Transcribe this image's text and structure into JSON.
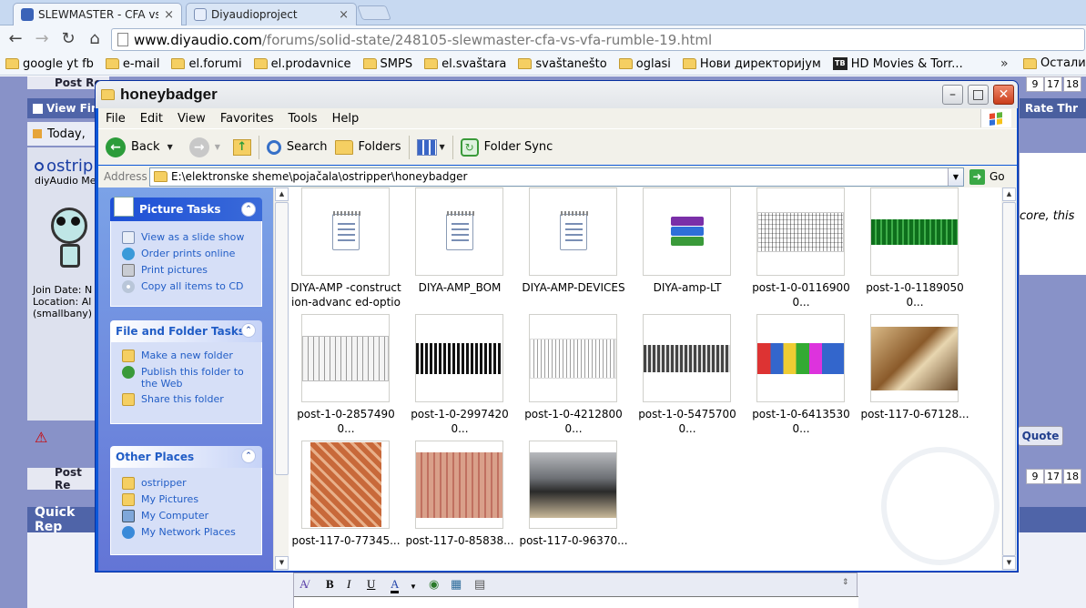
{
  "browser": {
    "tabs": [
      {
        "title": "SLEWMASTER - CFA vs.",
        "active": true,
        "close": "×"
      },
      {
        "title": "Diyaudioproject",
        "active": false,
        "close": "×"
      }
    ],
    "url_host": "www.diyaudio.com",
    "url_path": "/forums/solid-state/248105-slewmaster-cfa-vs-vfa-rumble-19.html",
    "bookmarks": [
      "google yt fb",
      "e-mail",
      "el.forumi",
      "el.prodavnice",
      "SMPS",
      "el.svaštara",
      "svaštanešto",
      "oglasi",
      "Нови директоријум",
      "HD Movies & Torr..."
    ],
    "bookmarks_more": "»",
    "bookmarks_other": "Остали о",
    "tb_logo": "TB"
  },
  "forum": {
    "post_reply": "Post Re",
    "view_first": "View Fir",
    "today": "Today,",
    "username": "ostrip",
    "user_title": "diyAudio Me",
    "join_date": "Join Date: N",
    "location": "Location: Al",
    "smallbany": "(smallbany)",
    "rate_thread": "Rate Thr",
    "page_numbers": [
      "9",
      "17",
      "18"
    ],
    "post_text": "core, this",
    "quote": "Quote",
    "post_reply_2": "Post Re",
    "quick_reply": "Quick Rep"
  },
  "explorer": {
    "title": "honeybadger",
    "menu": [
      "File",
      "Edit",
      "View",
      "Favorites",
      "Tools",
      "Help"
    ],
    "toolbar": {
      "back": "Back",
      "search": "Search",
      "folders": "Folders",
      "folder_sync": "Folder Sync"
    },
    "address_label": "Address",
    "address_value": "E:\\elektronske sheme\\pojačala\\ostripper\\honeybadger",
    "go": "Go",
    "picture_tasks": {
      "title": "Picture Tasks",
      "items": [
        "View as a slide show",
        "Order prints online",
        "Print pictures",
        "Copy all items to CD"
      ]
    },
    "file_folder_tasks": {
      "title": "File and Folder Tasks",
      "items": [
        "Make a new folder",
        "Publish this folder to the Web",
        "Share this folder"
      ]
    },
    "other_places": {
      "title": "Other Places",
      "items": [
        "ostripper",
        "My Pictures",
        "My Computer",
        "My Network Places"
      ]
    },
    "files": [
      {
        "name": "DIYA-AMP -construction-advanc ed-options",
        "kind": "doc"
      },
      {
        "name": "DIYA-AMP_BOM",
        "kind": "doc"
      },
      {
        "name": "DIYA-AMP-DEVICES",
        "kind": "doc"
      },
      {
        "name": "DIYA-amp-LT",
        "kind": "rar"
      },
      {
        "name": "post-1-0-01169000...",
        "kind": "schem"
      },
      {
        "name": "post-1-0-11890500...",
        "kind": "pcb-green"
      },
      {
        "name": "post-1-0-28574900...",
        "kind": "schem-gray"
      },
      {
        "name": "post-1-0-29974200...",
        "kind": "pcb-black"
      },
      {
        "name": "post-1-0-42128000...",
        "kind": "schem"
      },
      {
        "name": "post-1-0-54757000...",
        "kind": "pcb-gray"
      },
      {
        "name": "post-1-0-64135300...",
        "kind": "pcb-color"
      },
      {
        "name": "post-117-0-67128...",
        "kind": "photo-board"
      },
      {
        "name": "post-117-0-77345...",
        "kind": "photo-copper"
      },
      {
        "name": "post-117-0-85838...",
        "kind": "photo-pink"
      },
      {
        "name": "post-117-0-96370...",
        "kind": "photo-amp"
      }
    ]
  },
  "colors": {
    "xp_blue": "#0c57d8",
    "task_link": "#215dc6",
    "forum_bg": "#8892c8"
  }
}
